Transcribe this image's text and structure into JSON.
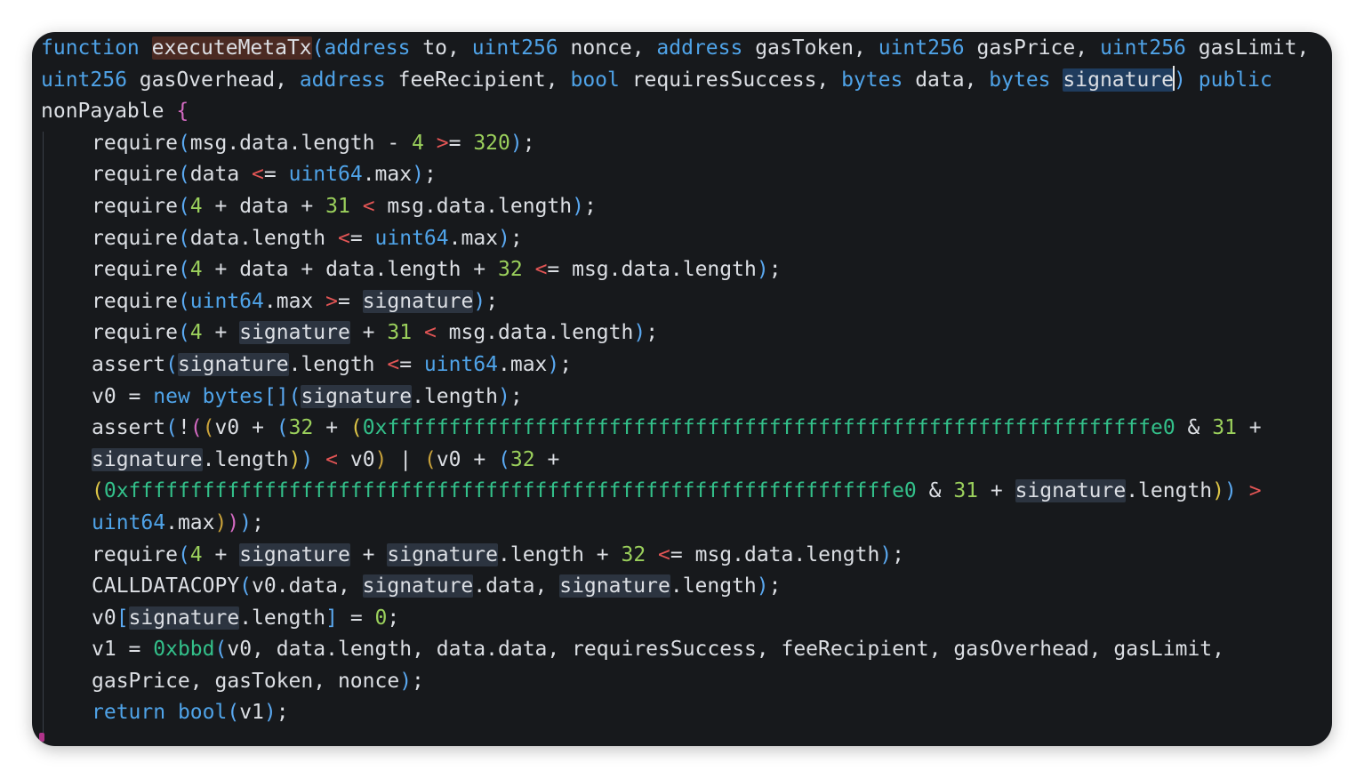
{
  "editor": {
    "lines": [
      {
        "indent": false,
        "tokens": [
          {
            "t": "function",
            "c": "kw"
          },
          {
            "t": " "
          },
          {
            "t": "executeMetaTx",
            "c": "hl-fn"
          },
          {
            "t": "(",
            "c": "br"
          },
          {
            "t": "address",
            "c": "kw"
          },
          {
            "t": " to, "
          },
          {
            "t": "uint256",
            "c": "kw"
          },
          {
            "t": " nonce, "
          },
          {
            "t": "address",
            "c": "kw"
          },
          {
            "t": " gasToken, "
          },
          {
            "t": "uint256",
            "c": "kw"
          },
          {
            "t": " gasPrice, "
          },
          {
            "t": "uint256",
            "c": "kw"
          },
          {
            "t": " gasLimit,"
          }
        ]
      },
      {
        "indent": false,
        "tokens": [
          {
            "t": "uint256",
            "c": "kw"
          },
          {
            "t": " gasOverhead, "
          },
          {
            "t": "address",
            "c": "kw"
          },
          {
            "t": " feeRecipient, "
          },
          {
            "t": "bool",
            "c": "kw"
          },
          {
            "t": " requiresSuccess, "
          },
          {
            "t": "bytes",
            "c": "kw"
          },
          {
            "t": " data, "
          },
          {
            "t": "bytes",
            "c": "kw"
          },
          {
            "t": " "
          },
          {
            "t": "signature",
            "c": "hl-sel"
          },
          {
            "t": "",
            "c": "caret"
          },
          {
            "t": ")",
            "c": "br"
          },
          {
            "t": " "
          },
          {
            "t": "public",
            "c": "kw"
          }
        ]
      },
      {
        "indent": false,
        "tokens": [
          {
            "t": "nonPayable "
          },
          {
            "t": "{",
            "c": "brP"
          }
        ]
      },
      {
        "indent": true,
        "tokens": [
          {
            "t": "require"
          },
          {
            "t": "(",
            "c": "br"
          },
          {
            "t": "msg.data.length - "
          },
          {
            "t": "4",
            "c": "num"
          },
          {
            "t": " "
          },
          {
            "t": ">",
            "c": "op"
          },
          {
            "t": "= "
          },
          {
            "t": "320",
            "c": "num"
          },
          {
            "t": ")",
            "c": "br"
          },
          {
            "t": ";"
          }
        ]
      },
      {
        "indent": true,
        "tokens": [
          {
            "t": "require"
          },
          {
            "t": "(",
            "c": "br"
          },
          {
            "t": "data "
          },
          {
            "t": "<",
            "c": "op"
          },
          {
            "t": "= "
          },
          {
            "t": "uint64",
            "c": "kw"
          },
          {
            "t": ".max"
          },
          {
            "t": ")",
            "c": "br"
          },
          {
            "t": ";"
          }
        ]
      },
      {
        "indent": true,
        "tokens": [
          {
            "t": "require"
          },
          {
            "t": "(",
            "c": "br"
          },
          {
            "t": "4",
            "c": "num"
          },
          {
            "t": " + data + "
          },
          {
            "t": "31",
            "c": "num"
          },
          {
            "t": " "
          },
          {
            "t": "<",
            "c": "op"
          },
          {
            "t": " msg.data.length"
          },
          {
            "t": ")",
            "c": "br"
          },
          {
            "t": ";"
          }
        ]
      },
      {
        "indent": true,
        "tokens": [
          {
            "t": "require"
          },
          {
            "t": "(",
            "c": "br"
          },
          {
            "t": "data.length "
          },
          {
            "t": "<",
            "c": "op"
          },
          {
            "t": "= "
          },
          {
            "t": "uint64",
            "c": "kw"
          },
          {
            "t": ".max"
          },
          {
            "t": ")",
            "c": "br"
          },
          {
            "t": ";"
          }
        ]
      },
      {
        "indent": true,
        "tokens": [
          {
            "t": "require"
          },
          {
            "t": "(",
            "c": "br"
          },
          {
            "t": "4",
            "c": "num"
          },
          {
            "t": " + data + data.length + "
          },
          {
            "t": "32",
            "c": "num"
          },
          {
            "t": " "
          },
          {
            "t": "<",
            "c": "op"
          },
          {
            "t": "= msg.data.length"
          },
          {
            "t": ")",
            "c": "br"
          },
          {
            "t": ";"
          }
        ]
      },
      {
        "indent": true,
        "tokens": [
          {
            "t": "require"
          },
          {
            "t": "(",
            "c": "br"
          },
          {
            "t": "uint64",
            "c": "kw"
          },
          {
            "t": ".max "
          },
          {
            "t": ">",
            "c": "op"
          },
          {
            "t": "= "
          },
          {
            "t": "signature",
            "c": "hl"
          },
          {
            "t": ")",
            "c": "br"
          },
          {
            "t": ";"
          }
        ]
      },
      {
        "indent": true,
        "tokens": [
          {
            "t": "require"
          },
          {
            "t": "(",
            "c": "br"
          },
          {
            "t": "4",
            "c": "num"
          },
          {
            "t": " + "
          },
          {
            "t": "signature",
            "c": "hl"
          },
          {
            "t": " + "
          },
          {
            "t": "31",
            "c": "num"
          },
          {
            "t": " "
          },
          {
            "t": "<",
            "c": "op"
          },
          {
            "t": " msg.data.length"
          },
          {
            "t": ")",
            "c": "br"
          },
          {
            "t": ";"
          }
        ]
      },
      {
        "indent": true,
        "tokens": [
          {
            "t": "assert"
          },
          {
            "t": "(",
            "c": "br"
          },
          {
            "t": "signature",
            "c": "hl"
          },
          {
            "t": ".length "
          },
          {
            "t": "<",
            "c": "op"
          },
          {
            "t": "= "
          },
          {
            "t": "uint64",
            "c": "kw"
          },
          {
            "t": ".max"
          },
          {
            "t": ")",
            "c": "br"
          },
          {
            "t": ";"
          }
        ]
      },
      {
        "indent": true,
        "tokens": [
          {
            "t": "v0 = "
          },
          {
            "t": "new",
            "c": "kw"
          },
          {
            "t": " "
          },
          {
            "t": "bytes",
            "c": "kw"
          },
          {
            "t": "[]",
            "c": "br"
          },
          {
            "t": "(",
            "c": "br"
          },
          {
            "t": "signature",
            "c": "hl"
          },
          {
            "t": ".length"
          },
          {
            "t": ")",
            "c": "br"
          },
          {
            "t": ";"
          }
        ]
      },
      {
        "indent": true,
        "tokens": [
          {
            "t": "assert"
          },
          {
            "t": "(",
            "c": "br"
          },
          {
            "t": "!"
          },
          {
            "t": "(",
            "c": "brP"
          },
          {
            "t": "(",
            "c": "br2"
          },
          {
            "t": "v0 + "
          },
          {
            "t": "(",
            "c": "br"
          },
          {
            "t": "32",
            "c": "num"
          },
          {
            "t": " + "
          },
          {
            "t": "(",
            "c": "brY"
          },
          {
            "t": "0xffffffffffffffffffffffffffffffffffffffffffffffffffffffffffffffe0",
            "c": "hex"
          },
          {
            "t": " & "
          },
          {
            "t": "31",
            "c": "num"
          },
          {
            "t": " +"
          }
        ]
      },
      {
        "indent": true,
        "tokens": [
          {
            "t": "signature",
            "c": "hl"
          },
          {
            "t": ".length"
          },
          {
            "t": ")",
            "c": "brY"
          },
          {
            "t": ")",
            "c": "br"
          },
          {
            "t": " "
          },
          {
            "t": "<",
            "c": "op"
          },
          {
            "t": " v0"
          },
          {
            "t": ")",
            "c": "br2"
          },
          {
            "t": " | "
          },
          {
            "t": "(",
            "c": "br2"
          },
          {
            "t": "v0 + "
          },
          {
            "t": "(",
            "c": "br"
          },
          {
            "t": "32",
            "c": "num"
          },
          {
            "t": " +"
          }
        ]
      },
      {
        "indent": true,
        "tokens": [
          {
            "t": "(",
            "c": "brY"
          },
          {
            "t": "0xffffffffffffffffffffffffffffffffffffffffffffffffffffffffffffffe0",
            "c": "hex"
          },
          {
            "t": " & "
          },
          {
            "t": "31",
            "c": "num"
          },
          {
            "t": " + "
          },
          {
            "t": "signature",
            "c": "hl"
          },
          {
            "t": ".length"
          },
          {
            "t": ")",
            "c": "brY"
          },
          {
            "t": ")",
            "c": "br"
          },
          {
            "t": " "
          },
          {
            "t": ">",
            "c": "op"
          }
        ]
      },
      {
        "indent": true,
        "tokens": [
          {
            "t": "uint64",
            "c": "kw"
          },
          {
            "t": ".max"
          },
          {
            "t": ")",
            "c": "br2"
          },
          {
            "t": ")",
            "c": "brP"
          },
          {
            "t": ")",
            "c": "br"
          },
          {
            "t": ";"
          }
        ]
      },
      {
        "indent": true,
        "tokens": [
          {
            "t": "require"
          },
          {
            "t": "(",
            "c": "br"
          },
          {
            "t": "4",
            "c": "num"
          },
          {
            "t": " + "
          },
          {
            "t": "signature",
            "c": "hl"
          },
          {
            "t": " + "
          },
          {
            "t": "signature",
            "c": "hl"
          },
          {
            "t": ".length + "
          },
          {
            "t": "32",
            "c": "num"
          },
          {
            "t": " "
          },
          {
            "t": "<",
            "c": "op"
          },
          {
            "t": "= msg.data.length"
          },
          {
            "t": ")",
            "c": "br"
          },
          {
            "t": ";"
          }
        ]
      },
      {
        "indent": true,
        "tokens": [
          {
            "t": "CALLDATACOPY"
          },
          {
            "t": "(",
            "c": "br"
          },
          {
            "t": "v0.data, "
          },
          {
            "t": "signature",
            "c": "hl"
          },
          {
            "t": ".data, "
          },
          {
            "t": "signature",
            "c": "hl"
          },
          {
            "t": ".length"
          },
          {
            "t": ")",
            "c": "br"
          },
          {
            "t": ";"
          }
        ]
      },
      {
        "indent": true,
        "tokens": [
          {
            "t": "v0"
          },
          {
            "t": "[",
            "c": "br"
          },
          {
            "t": "signature",
            "c": "hl"
          },
          {
            "t": ".length"
          },
          {
            "t": "]",
            "c": "br"
          },
          {
            "t": " = "
          },
          {
            "t": "0",
            "c": "num"
          },
          {
            "t": ";"
          }
        ]
      },
      {
        "indent": true,
        "tokens": [
          {
            "t": "v1 = "
          },
          {
            "t": "0xbbd",
            "c": "hex"
          },
          {
            "t": "(",
            "c": "br"
          },
          {
            "t": "v0, data.length, data.data, requiresSuccess, feeRecipient, gasOverhead, gasLimit,"
          }
        ]
      },
      {
        "indent": true,
        "tokens": [
          {
            "t": "gasPrice, gasToken, nonce"
          },
          {
            "t": ")",
            "c": "br"
          },
          {
            "t": ";"
          }
        ]
      },
      {
        "indent": true,
        "tokens": [
          {
            "t": "return",
            "c": "kw"
          },
          {
            "t": " "
          },
          {
            "t": "bool",
            "c": "kw"
          },
          {
            "t": "(",
            "c": "br"
          },
          {
            "t": "v1"
          },
          {
            "t": ")",
            "c": "br"
          },
          {
            "t": ";"
          }
        ]
      }
    ]
  },
  "colors": {
    "background": "#17191c",
    "keyword": "#4fa3e8",
    "number": "#9bd05c",
    "hex_literal": "#33c08a",
    "operator": "#e35555",
    "text": "#dcdfe4"
  }
}
